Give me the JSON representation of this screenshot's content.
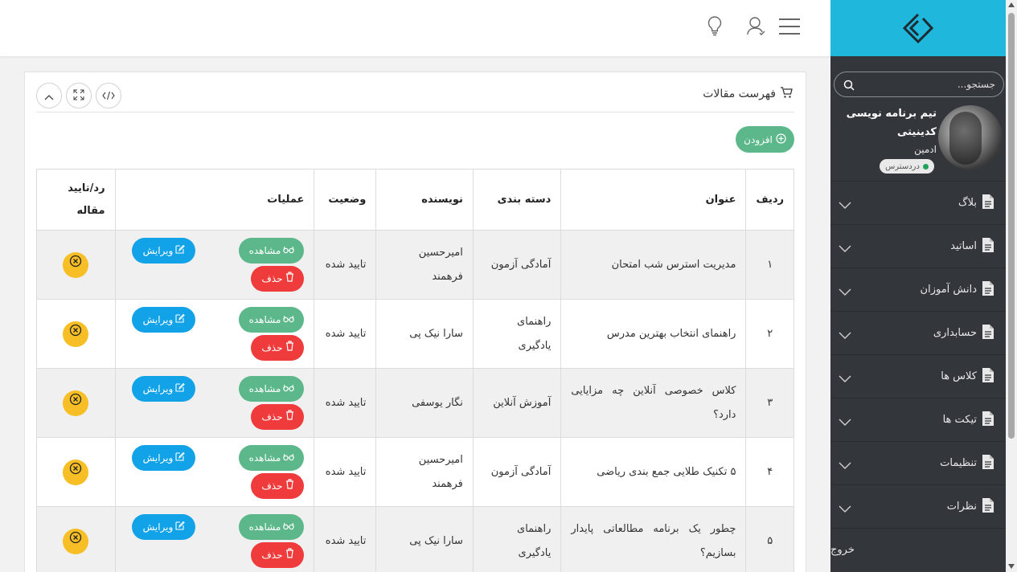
{
  "sidebar": {
    "search_placeholder": "جستجو...",
    "user_name_line1": "تیم برنامه نویسی",
    "user_name_line2": "کدینیتی",
    "user_role": "ادمین",
    "status": "دردسترس",
    "menu": [
      {
        "label": "بلاگ"
      },
      {
        "label": "اساتید"
      },
      {
        "label": "دانش آموزان"
      },
      {
        "label": "حسابداری"
      },
      {
        "label": "کلاس ها"
      },
      {
        "label": "تیکت ها"
      },
      {
        "label": "تنظیمات"
      },
      {
        "label": "نظرات"
      }
    ],
    "logout": "خروج"
  },
  "card": {
    "title": "فهرست مقالات",
    "add_label": "افزودن"
  },
  "table": {
    "headers": {
      "row": "ردیف",
      "title": "عنوان",
      "category": "دسته بندی",
      "author": "نویسنده",
      "status": "وضعیت",
      "ops": "عملیات",
      "reject": "رد/تایید مقاله"
    },
    "actions": {
      "view": "مشاهده",
      "delete": "حذف",
      "edit": "ویرایش"
    },
    "rows": [
      {
        "num": "١",
        "title": "مدیریت استرس شب امتحان",
        "category": "آمادگی آزمون",
        "author": "امیرحسین فرهمند",
        "status": "تایید شده"
      },
      {
        "num": "٢",
        "title": "راهنمای انتخاب بهترین مدرس",
        "category": "راهنمای یادگیری",
        "author": "سارا نیک پی",
        "status": "تایید شده"
      },
      {
        "num": "٣",
        "title": "کلاس خصوصی آنلاین چه مزایایی دارد؟",
        "category": "آموزش آنلاین",
        "author": "نگار یوسفی",
        "status": "تایید شده"
      },
      {
        "num": "۴",
        "title": "۵ تکنیک طلایی جمع بندی ریاضی",
        "category": "آمادگی آزمون",
        "author": "امیرحسین فرهمند",
        "status": "تایید شده"
      },
      {
        "num": "۵",
        "title": "چطور یک برنامه مطالعاتی پایدار بسازیم؟",
        "category": "راهنمای یادگیری",
        "author": "سارا نیک پی",
        "status": "تایید شده"
      }
    ]
  },
  "colors": {
    "brand": "#1fb8dc",
    "sidebar_bg": "#33363b",
    "view": "#5cb88a",
    "delete": "#ef3b3b",
    "edit": "#12a2e8",
    "reject": "#f7be25"
  }
}
